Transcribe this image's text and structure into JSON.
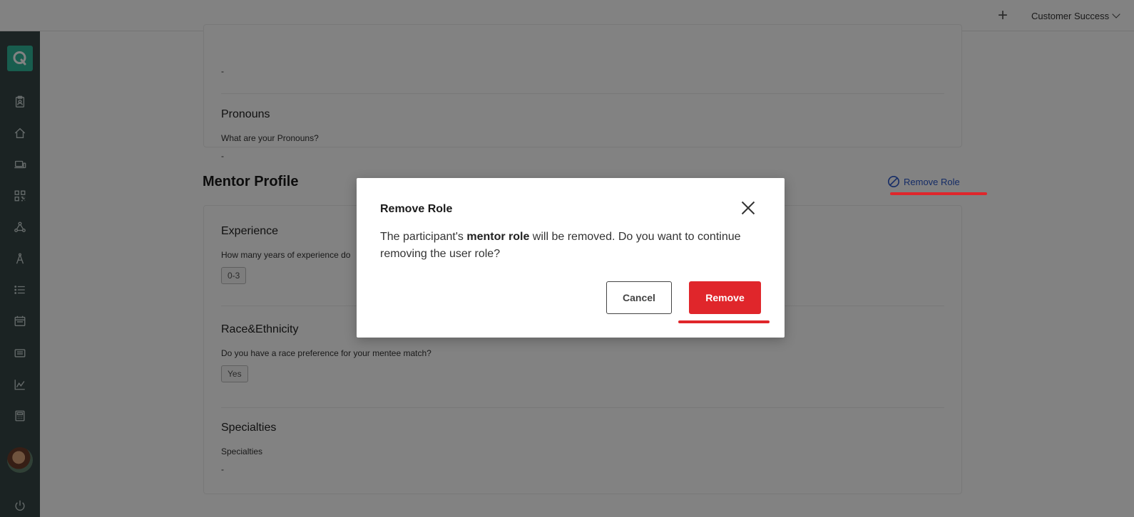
{
  "topbar": {
    "add_icon": "plus-icon",
    "account_label": "Customer Success"
  },
  "sidebar": {
    "logo_letter": "Q",
    "items": [
      "clipboard-user-icon",
      "home-icon",
      "laptop-icon",
      "qr-code-icon",
      "network-icon",
      "compass-icon",
      "list-icon",
      "calendar-icon",
      "id-card-icon",
      "chart-line-icon",
      "calculator-icon"
    ],
    "power_icon": "power-icon"
  },
  "page": {
    "top_dash": "-",
    "pronouns": {
      "title": "Pronouns",
      "question": "What are your Pronouns?",
      "answer": "-"
    },
    "mentor_profile": {
      "heading": "Mentor Profile",
      "remove_role_label": "Remove Role",
      "experience": {
        "title": "Experience",
        "question": "How many years of experience do",
        "answer_chip": "0-3"
      },
      "race": {
        "title": "Race&Ethnicity",
        "question": "Do you have a race preference for your mentee match?",
        "answer_chip": "Yes"
      },
      "specialties": {
        "title": "Specialties",
        "question": "Specialties",
        "answer": "-"
      }
    }
  },
  "dialog": {
    "title": "Remove Role",
    "body_prefix": "The participant's ",
    "body_bold": "mentor role",
    "body_suffix": " will be removed. Do you want to continue removing the user role?",
    "cancel_label": "Cancel",
    "remove_label": "Remove"
  },
  "colors": {
    "sidebar": "#354645",
    "logo": "#2fb69a",
    "danger": "#e0262b",
    "link": "#2a57c9",
    "highlight_underline": "#e0262b"
  }
}
